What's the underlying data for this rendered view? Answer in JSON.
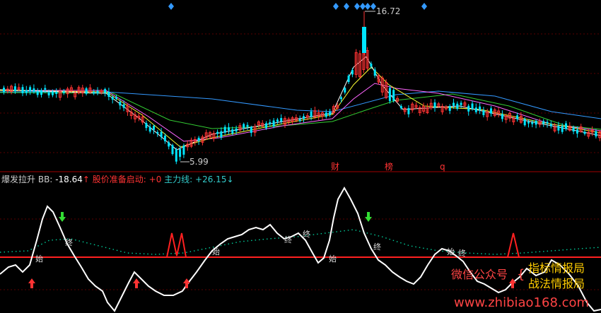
{
  "upper_panel": {
    "high_label": "16.72",
    "low_label": "5.99",
    "markers": [
      "财",
      "榜",
      "q"
    ],
    "colors": {
      "up": "#ff3333",
      "down": "#00e5ff",
      "ma5": "#ffffff",
      "ma10": "#ffff33",
      "ma20": "#ff66ff",
      "ma40": "#33cc33",
      "ma60": "#3399ff",
      "diamond": "#3399ff"
    }
  },
  "indicator_header": {
    "name": "爆发拉升",
    "bb_label": "BB:",
    "bb_value": "-18.64",
    "bb_arrow": "↑",
    "ready_label": "股价准备启动:",
    "ready_value": "+0",
    "main_label": "主力线:",
    "main_value": "+26.15",
    "main_arrow": "↓"
  },
  "signals": {
    "start": "始",
    "end": "终"
  },
  "watermark": {
    "wechat": "微信公众号",
    "account_1": "指标情报局",
    "account_2": "战法情报局",
    "site": "www.zhibiao168.com"
  },
  "chart_data": {
    "type": "candlestick",
    "indicator": {
      "type": "line",
      "baseline_value": 0,
      "series": [
        {
          "name": "BB",
          "color": "#ffffff"
        },
        {
          "name": "主力线",
          "color": "#00cc99"
        }
      ]
    }
  }
}
